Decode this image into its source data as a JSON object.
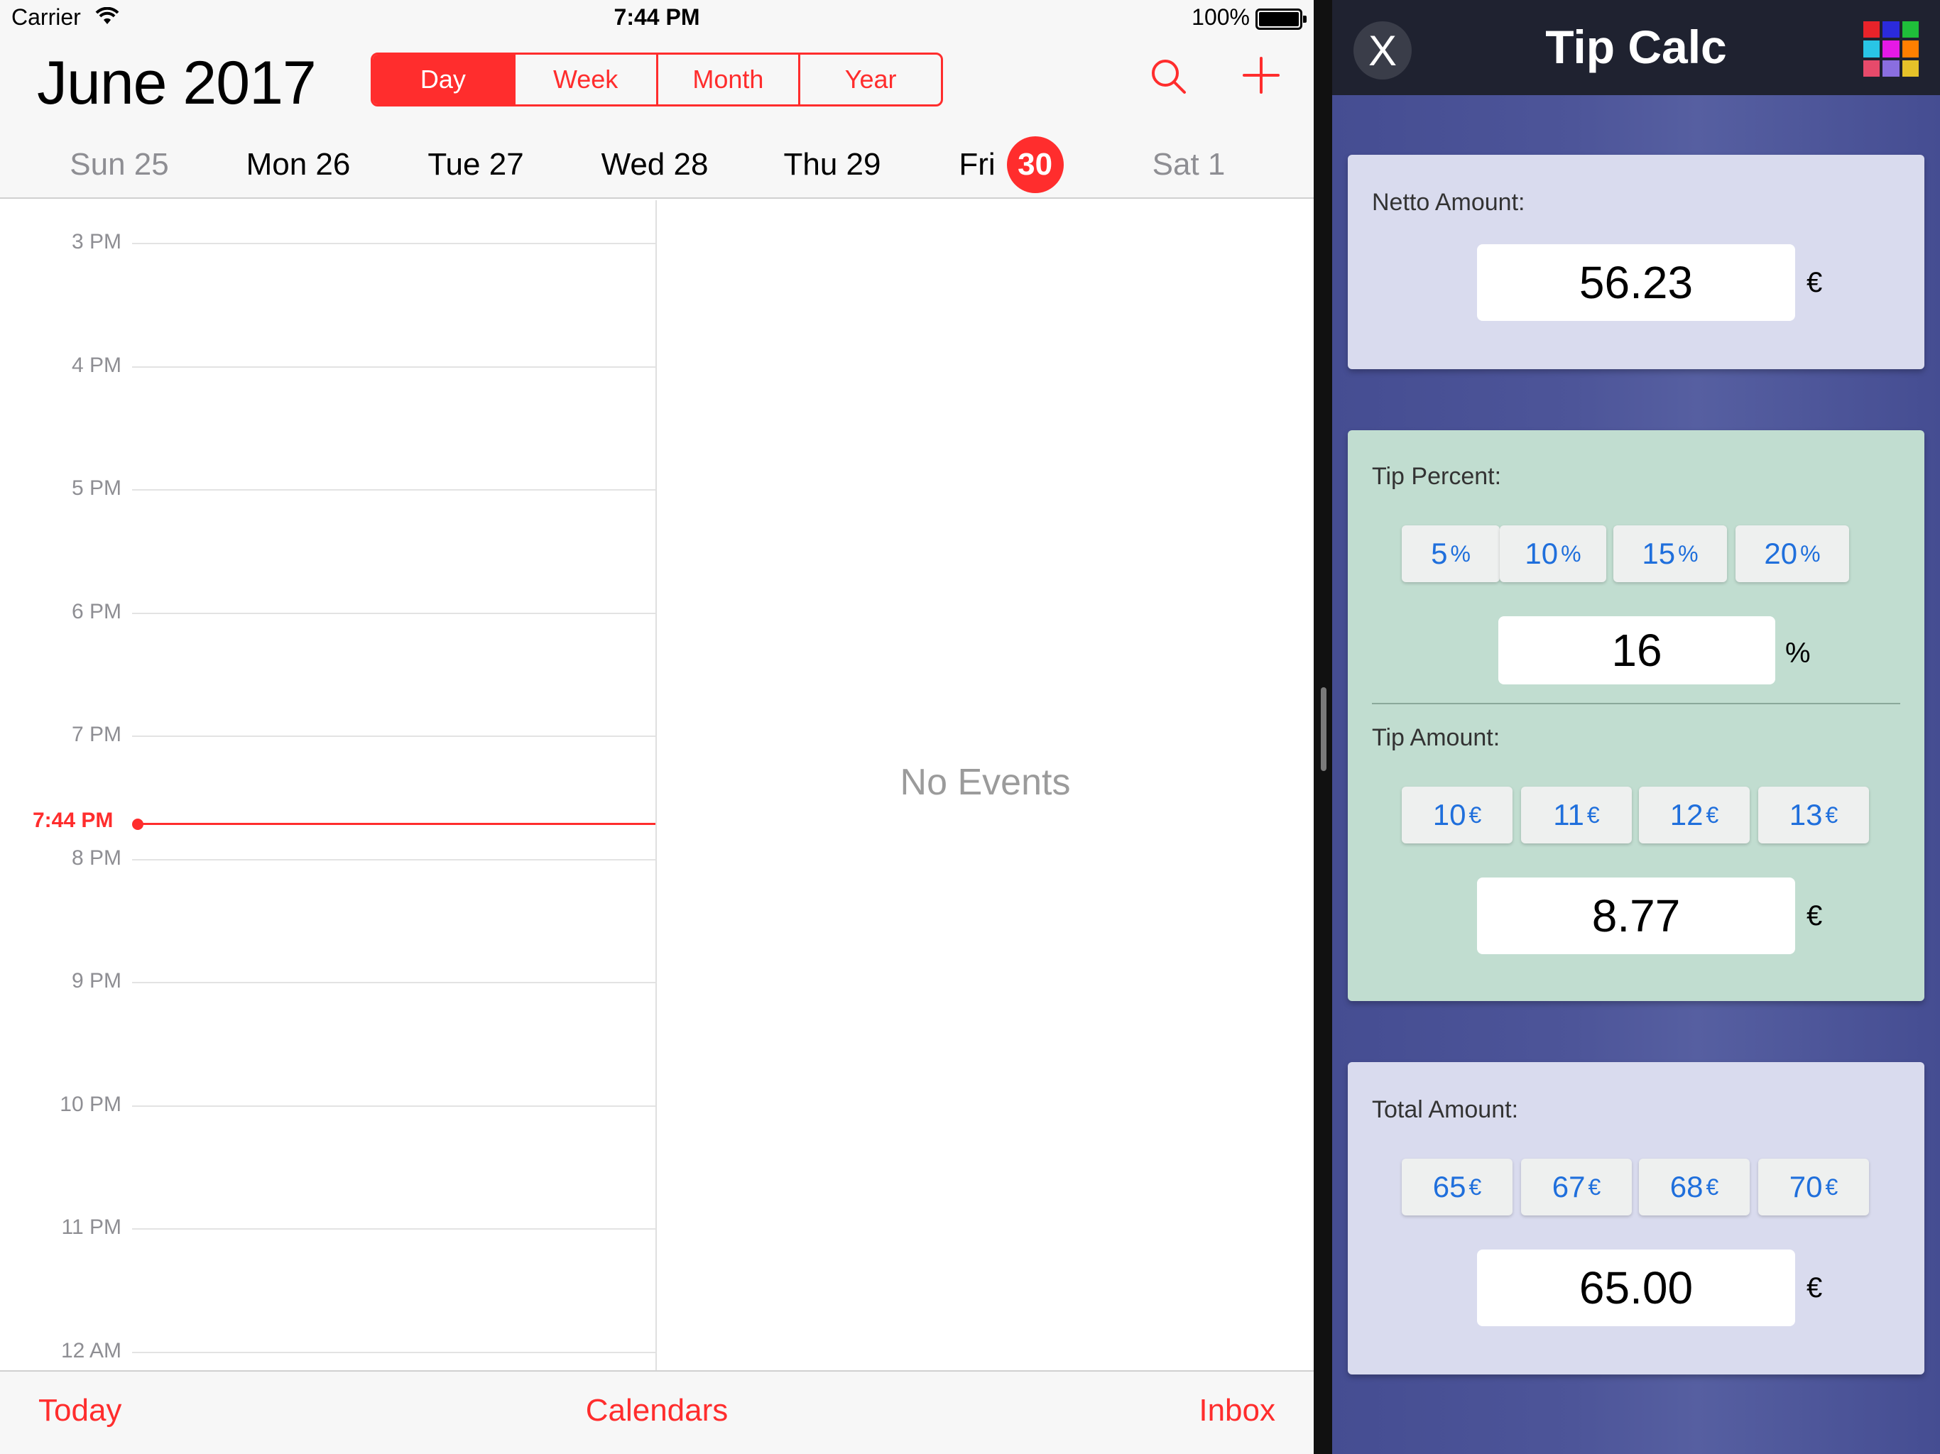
{
  "status_bar": {
    "carrier": "Carrier",
    "time": "7:44 PM",
    "battery_percent": "100%"
  },
  "calendar": {
    "month": "June",
    "year": "2017",
    "view_segments": [
      "Day",
      "Week",
      "Month",
      "Year"
    ],
    "active_segment": "Day",
    "accent_color": "#ff2d2d",
    "week_days": [
      {
        "label": "Sun 25",
        "muted": true
      },
      {
        "label": "Mon 26",
        "muted": false
      },
      {
        "label": "Tue 27",
        "muted": false
      },
      {
        "label": "Wed 28",
        "muted": false
      },
      {
        "label": "Thu 29",
        "muted": false
      },
      {
        "label": "Fri",
        "number": "30",
        "selected": true
      },
      {
        "label": "Sat 1",
        "muted": true
      }
    ],
    "hours": [
      "3 PM",
      "4 PM",
      "5 PM",
      "6 PM",
      "7 PM",
      "8 PM",
      "9 PM",
      "10 PM",
      "11 PM",
      "12 AM"
    ],
    "now_label": "7:44 PM",
    "no_events": "No Events",
    "tabs": {
      "today": "Today",
      "calendars": "Calendars",
      "inbox": "Inbox"
    }
  },
  "tip_calc": {
    "close_label": "X",
    "title": "Tip Calc",
    "theme_colors": [
      "#e8232a",
      "#2b2bdc",
      "#1fbf3a",
      "#29c5e6",
      "#e619e6",
      "#ff7f00",
      "#e64a6b",
      "#8a6ee0",
      "#e6c229"
    ],
    "netto": {
      "label": "Netto Amount:",
      "value": "56.23",
      "unit": "€"
    },
    "tip_percent": {
      "label": "Tip Percent:",
      "presets": [
        {
          "value": "5",
          "unit": "%"
        },
        {
          "value": "10",
          "unit": "%"
        },
        {
          "value": "15",
          "unit": "%"
        },
        {
          "value": "20",
          "unit": "%"
        }
      ],
      "value": "16",
      "unit": "%"
    },
    "tip_amount": {
      "label": "Tip Amount:",
      "presets": [
        {
          "value": "10",
          "unit": "€"
        },
        {
          "value": "11",
          "unit": "€"
        },
        {
          "value": "12",
          "unit": "€"
        },
        {
          "value": "13",
          "unit": "€"
        }
      ],
      "value": "8.77",
      "unit": "€"
    },
    "total": {
      "label": "Total Amount:",
      "presets": [
        {
          "value": "65",
          "unit": "€"
        },
        {
          "value": "67",
          "unit": "€"
        },
        {
          "value": "68",
          "unit": "€"
        },
        {
          "value": "70",
          "unit": "€"
        }
      ],
      "value": "65.00",
      "unit": "€"
    }
  }
}
